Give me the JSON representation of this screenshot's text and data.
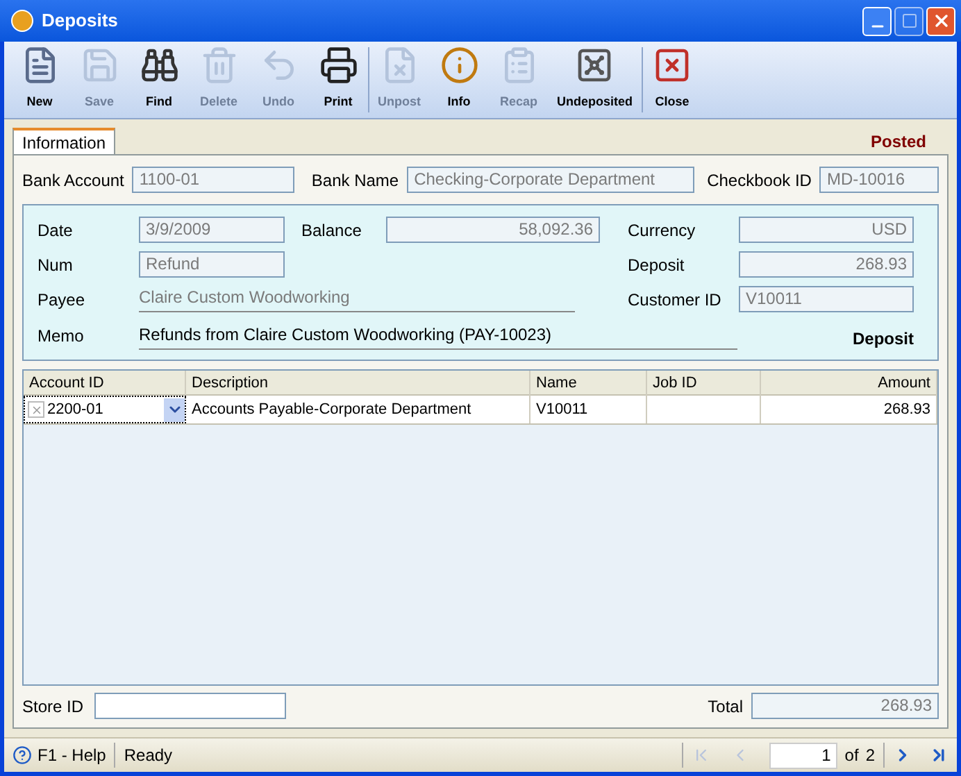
{
  "window": {
    "title": "Deposits"
  },
  "toolbar": [
    {
      "label": "New",
      "disabled": false
    },
    {
      "label": "Save",
      "disabled": true
    },
    {
      "label": "Find",
      "disabled": false
    },
    {
      "label": "Delete",
      "disabled": true
    },
    {
      "label": "Undo",
      "disabled": true
    },
    {
      "label": "Print",
      "disabled": false
    },
    {
      "label": "Unpost",
      "disabled": true
    },
    {
      "label": "Info",
      "disabled": false
    },
    {
      "label": "Recap",
      "disabled": true
    },
    {
      "label": "Undeposited",
      "disabled": false
    },
    {
      "label": "Close",
      "disabled": false
    }
  ],
  "tabs": [
    {
      "label": "Information",
      "selected": true
    }
  ],
  "posted_label": "Posted",
  "header": {
    "bank_account": {
      "label": "Bank Account",
      "value": "1100-01"
    },
    "bank_name": {
      "label": "Bank Name",
      "value": "Checking-Corporate Department"
    },
    "checkbook_id": {
      "label": "Checkbook ID",
      "value": "MD-10016"
    }
  },
  "details": {
    "date": {
      "label": "Date",
      "value": "3/9/2009"
    },
    "balance": {
      "label": "Balance",
      "value": "58,092.36"
    },
    "currency": {
      "label": "Currency",
      "value": "USD"
    },
    "num": {
      "label": "Num",
      "value": "Refund"
    },
    "deposit": {
      "label": "Deposit",
      "value": "268.93"
    },
    "payee": {
      "label": "Payee",
      "value": "Claire Custom Woodworking"
    },
    "customer_id": {
      "label": "Customer ID",
      "value": "V10011"
    },
    "memo": {
      "label": "Memo",
      "value": "Refunds from Claire Custom Woodworking (PAY-10023)"
    },
    "type_label": "Deposit"
  },
  "table": {
    "columns": [
      "Account ID",
      "Description",
      "Name",
      "Job ID",
      "Amount"
    ],
    "rows": [
      [
        "2200-01",
        "Accounts Payable-Corporate Department",
        "V10011",
        "",
        "268.93"
      ]
    ]
  },
  "footer": {
    "store_id": {
      "label": "Store ID"
    },
    "total": {
      "label": "Total",
      "value": "268.93"
    }
  },
  "status_bar": {
    "help": "F1 - Help",
    "status": "Ready",
    "page": "1",
    "of": "of",
    "pages": "2"
  }
}
